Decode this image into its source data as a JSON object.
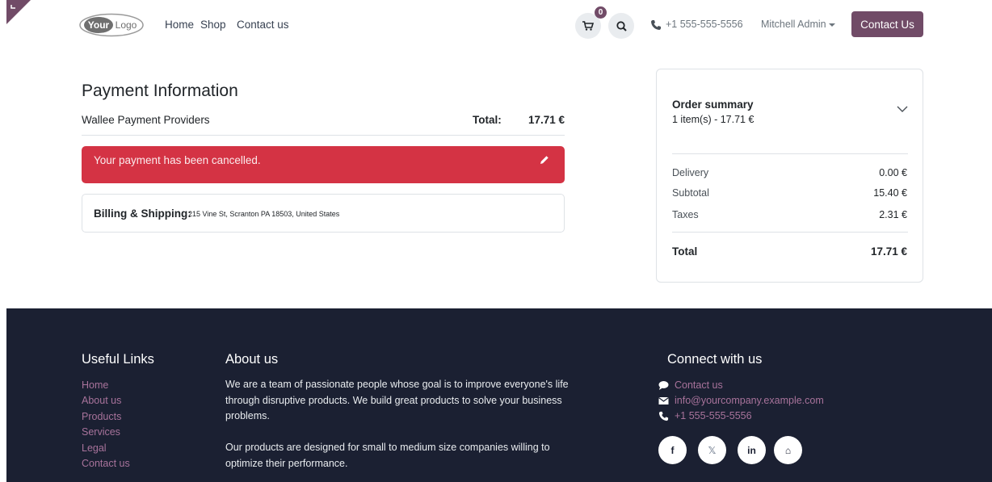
{
  "colors": {
    "brand": "#714b67",
    "alert": "#d43344",
    "footer_bg": "#1b2032",
    "footer_link": "#a8739b"
  },
  "header": {
    "logo_text": "YourLogo",
    "nav": [
      {
        "label": "Home"
      },
      {
        "label": "Shop"
      },
      {
        "label": "Contact us"
      }
    ],
    "cart_count": "0",
    "phone": "+1 555-555-5556",
    "user": "Mitchell Admin",
    "contact_button": "Contact Us",
    "icons": [
      "cart-icon",
      "search-icon",
      "phone-icon",
      "caret-down-icon"
    ]
  },
  "payment": {
    "title": "Payment Information",
    "provider": "Wallee Payment Providers",
    "total_label": "Total:",
    "total_value": "17.71 €",
    "alert_text": "Your payment has been cancelled.",
    "billing_label": "Billing & Shipping:",
    "billing_address": "215 Vine St, Scranton PA 18503, United States"
  },
  "summary": {
    "title": "Order summary",
    "items_line": "1 item(s) -  17.71 €",
    "rows": [
      {
        "label": "Delivery",
        "value": "0.00 €"
      },
      {
        "label": "Subtotal",
        "value": "15.40 €"
      },
      {
        "label": "Taxes",
        "value": "2.31 €"
      }
    ],
    "total_label": "Total",
    "total_value": "17.71 €"
  },
  "footer": {
    "useful_links_title": "Useful Links",
    "useful_links": [
      "Home",
      "About us",
      "Products",
      "Services",
      "Legal",
      "Contact us"
    ],
    "about_title": "About us",
    "about_p1": "We are a team of passionate people whose goal is to improve everyone's life through disruptive products. We build great products to solve your business problems.",
    "about_p2": "Our products are designed for small to medium size companies willing to optimize their performance.",
    "connect_title": "Connect with us",
    "contact_link": "Contact us",
    "email": "info@yourcompany.example.com",
    "phone": "+1 555-555-5556",
    "social": [
      {
        "name": "facebook",
        "glyph": "f"
      },
      {
        "name": "x",
        "glyph": "𝕏"
      },
      {
        "name": "linkedin",
        "glyph": "in"
      },
      {
        "name": "home",
        "glyph": "⌂"
      }
    ]
  }
}
